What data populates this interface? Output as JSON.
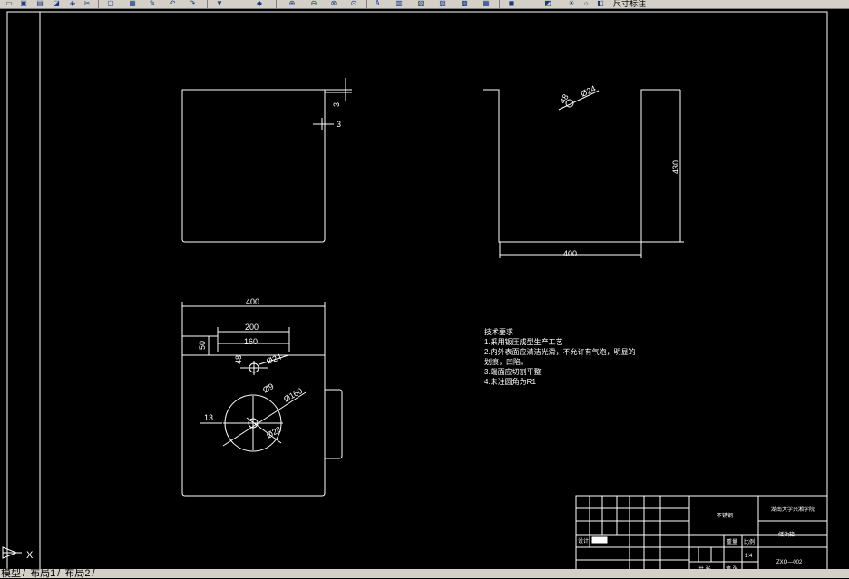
{
  "toolbar": {
    "icons": [
      "open-icon",
      "save-icon",
      "print-icon",
      "preview-icon",
      "publish-icon",
      "cut-icon",
      "copy-icon",
      "paste-icon",
      "match-icon",
      "undo-icon",
      "redo-icon",
      "pan-icon",
      "zoom-realtime-icon",
      "zoom-window-icon",
      "zoom-previous-icon",
      "properties-icon",
      "designcenter-icon",
      "toolpalettes-icon",
      "sheetset-icon",
      "markup-icon",
      "calculator-icon",
      "help-icon",
      "layer-icon",
      "layer-state-icon"
    ],
    "layer_text": "尺寸标注"
  },
  "views": {
    "side_right_dim": "3",
    "side_top_dim": "3",
    "front_hole_dim": "48",
    "front_hole_dia": "Ø24",
    "front_height": "430",
    "front_width": "400",
    "top_width": "400",
    "top_inner_width": "200",
    "top_inner2_width": "160",
    "top_depth": "50",
    "top_hole_dim": "48",
    "top_hole_dia": "Ø24",
    "circle_dim_1": "Ø9",
    "circle_dim_2": "Ø160",
    "circle_dim_3": "13",
    "circle_dim_4": "Ø28"
  },
  "notes": {
    "title": "技术要求",
    "lines": [
      "1.采用钣压成型生产工艺",
      "2.内外表面应清洁光滑，不允许有气泡，明显的",
      "划痕，凹陷。",
      "3.端面应切割平整",
      "4.未注圆角为R1"
    ]
  },
  "titleblock": {
    "material": "不锈钢",
    "school": "湖南大学兴湘学院",
    "part_name": "储油箱",
    "designer_label": "设计",
    "weight_label": "重量",
    "scale_label": "比例",
    "scale": "1:4",
    "drawing_no": "ZXQ—002",
    "sheets": "共 张",
    "sheet_no": "第 张"
  },
  "ucs": {
    "label": "X"
  },
  "tabs": [
    "模型",
    "布局1",
    "布局2"
  ]
}
